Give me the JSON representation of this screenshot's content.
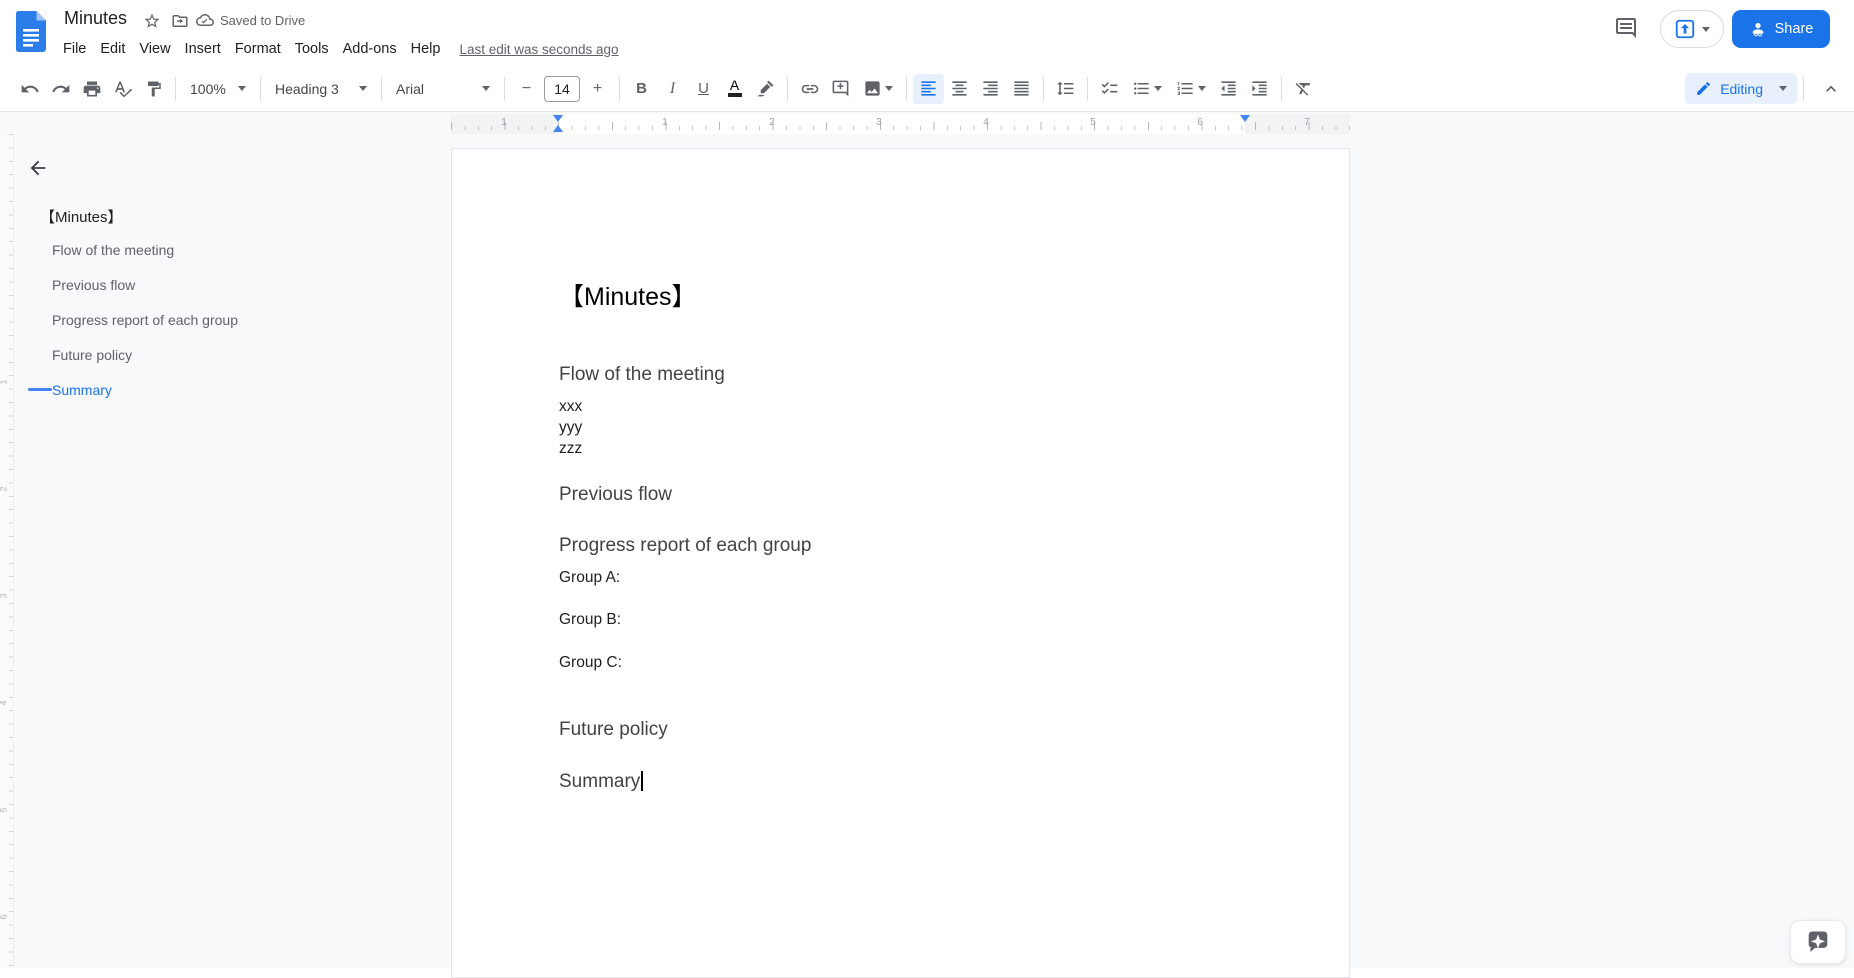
{
  "header": {
    "title": "Minutes",
    "saved_status": "Saved to Drive",
    "menus": [
      "File",
      "Edit",
      "View",
      "Insert",
      "Format",
      "Tools",
      "Add-ons",
      "Help"
    ],
    "last_edit": "Last edit was seconds ago",
    "share_label": "Share"
  },
  "toolbar": {
    "zoom_value": "100%",
    "paragraph_style": "Heading 3",
    "font_family": "Arial",
    "font_size": "14",
    "mode_label": "Editing",
    "glyphs": {
      "bold": "B",
      "italic": "I",
      "underline": "U",
      "text_color": "A",
      "minus": "−",
      "plus": "+"
    }
  },
  "outline": {
    "back_tooltip": "Close document outline",
    "items": [
      {
        "label": "【Minutes】"
      },
      {
        "label": "Flow of the meeting"
      },
      {
        "label": "Previous flow"
      },
      {
        "label": "Progress report of each group"
      },
      {
        "label": "Future policy"
      },
      {
        "label": "Summary"
      }
    ],
    "active_index": 5
  },
  "ruler": {
    "margin_number": "1",
    "numbers": [
      "1",
      "2",
      "3",
      "4",
      "5",
      "6",
      "7"
    ],
    "vertical_numbers": [
      "1",
      "2",
      "3",
      "4",
      "5",
      "6"
    ]
  },
  "doc": {
    "title": "【Minutes】",
    "lines": [
      {
        "type": "heading3",
        "text": "Flow of the meeting"
      },
      {
        "type": "body",
        "text": "xxx"
      },
      {
        "type": "body",
        "text": "yyy"
      },
      {
        "type": "body",
        "text": "zzz"
      },
      {
        "type": "heading3",
        "text": "Previous flow"
      },
      {
        "type": "heading3",
        "text": "Progress report of each group"
      },
      {
        "type": "body",
        "text": "Group A:"
      },
      {
        "type": "body",
        "text": "Group B:"
      },
      {
        "type": "body",
        "text": "Group C:"
      },
      {
        "type": "heading3",
        "text": "Future policy"
      },
      {
        "type": "heading3",
        "text": "Summary"
      }
    ]
  },
  "icons": [
    "docs-logo",
    "star",
    "move-folder",
    "cloud-check",
    "comment-history",
    "present",
    "share-person",
    "undo",
    "redo",
    "print",
    "spell-check",
    "paint-format",
    "link",
    "add-comment",
    "insert-image",
    "align-left",
    "align-center",
    "align-right",
    "justify",
    "line-spacing",
    "checklist",
    "bulleted-list",
    "numbered-list",
    "decrease-indent",
    "increase-indent",
    "clear-formatting",
    "pencil-edit",
    "collapse-chevron",
    "back-arrow",
    "explore-star"
  ],
  "colors": {
    "accent": "#1a73e8",
    "active_bg": "#e8f0fe",
    "canvas_bg": "#f8f9fa",
    "heading_text": "#434343",
    "ruler_marker": "#4285f4"
  }
}
